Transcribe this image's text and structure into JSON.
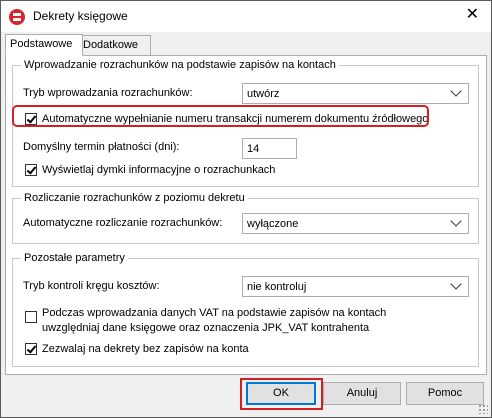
{
  "window": {
    "title": "Dekrety księgowe",
    "close_glyph": "✕",
    "icon": "app-logo-icon"
  },
  "tabs": [
    {
      "label": "Podstawowe",
      "active": true
    },
    {
      "label": "Dodatkowe",
      "active": false
    }
  ],
  "group1": {
    "legend": "Wprowadzanie rozrachunków na podstawie zapisów na kontach",
    "mode_label": "Tryb wprowadzania rozrachunków:",
    "mode_value": "utwórz",
    "autofill_label": "Automatyczne wypełnianie numeru transakcji numerem dokumentu źródłowego",
    "autofill_checked": true,
    "term_label": "Domyślny termin płatności (dni):",
    "term_value": "14",
    "tooltips_label": "Wyświetlaj dymki informacyjne o rozrachunkach",
    "tooltips_checked": true
  },
  "group2": {
    "legend": "Rozliczanie rozrachunków z poziomu dekretu",
    "auto_label": "Automatyczne rozliczanie rozrachunków:",
    "auto_value": "wyłączone"
  },
  "group3": {
    "legend": "Pozostałe parametry",
    "cost_label": "Tryb kontroli kręgu kosztów:",
    "cost_value": "nie kontroluj",
    "vat_label_line1": "Podczas wprowadzania danych VAT na podstawie zapisów na kontach",
    "vat_label_line2": "uwzględniaj dane księgowe oraz oznaczenia JPK_VAT kontrahenta",
    "vat_checked": false,
    "allow_label": "Zezwalaj na dekrety bez zapisów na konta",
    "allow_checked": true
  },
  "buttons": {
    "ok": "OK",
    "cancel": "Anuluj",
    "help": "Pomoc"
  },
  "colors": {
    "highlight": "#d42020",
    "focus": "#0078d7"
  }
}
